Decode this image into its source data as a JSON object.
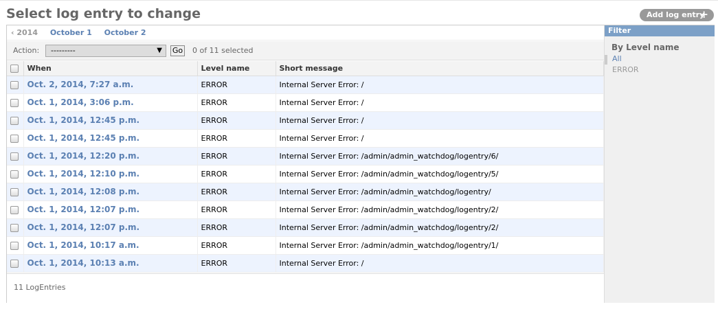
{
  "page": {
    "title": "Select log entry to change",
    "add_button": "Add log entry",
    "add_icon": "+"
  },
  "date_hierarchy": {
    "back": "‹ 2014",
    "items": [
      "October 1",
      "October 2"
    ]
  },
  "actions": {
    "label": "Action:",
    "selected_value": "---------",
    "caret": "▼",
    "go": "Go",
    "count": "0 of 11 selected"
  },
  "table": {
    "headers": [
      "When",
      "Level name",
      "Short message"
    ],
    "rows": [
      {
        "when": "Oct. 2, 2014, 7:27 a.m.",
        "level": "ERROR",
        "message": "Internal Server Error: /"
      },
      {
        "when": "Oct. 1, 2014, 3:06 p.m.",
        "level": "ERROR",
        "message": "Internal Server Error: /"
      },
      {
        "when": "Oct. 1, 2014, 12:45 p.m.",
        "level": "ERROR",
        "message": "Internal Server Error: /"
      },
      {
        "when": "Oct. 1, 2014, 12:45 p.m.",
        "level": "ERROR",
        "message": "Internal Server Error: /"
      },
      {
        "when": "Oct. 1, 2014, 12:20 p.m.",
        "level": "ERROR",
        "message": "Internal Server Error: /admin/admin_watchdog/logentry/6/"
      },
      {
        "when": "Oct. 1, 2014, 12:10 p.m.",
        "level": "ERROR",
        "message": "Internal Server Error: /admin/admin_watchdog/logentry/5/"
      },
      {
        "when": "Oct. 1, 2014, 12:08 p.m.",
        "level": "ERROR",
        "message": "Internal Server Error: /admin/admin_watchdog/logentry/"
      },
      {
        "when": "Oct. 1, 2014, 12:07 p.m.",
        "level": "ERROR",
        "message": "Internal Server Error: /admin/admin_watchdog/logentry/2/"
      },
      {
        "when": "Oct. 1, 2014, 12:07 p.m.",
        "level": "ERROR",
        "message": "Internal Server Error: /admin/admin_watchdog/logentry/2/"
      },
      {
        "when": "Oct. 1, 2014, 10:17 a.m.",
        "level": "ERROR",
        "message": "Internal Server Error: /admin/admin_watchdog/logentry/1/"
      },
      {
        "when": "Oct. 1, 2014, 10:13 a.m.",
        "level": "ERROR",
        "message": "Internal Server Error: /"
      }
    ]
  },
  "paginator": {
    "text": "11 LogEntries"
  },
  "filter": {
    "heading": "Filter",
    "group_title": "By Level name",
    "options": [
      "All",
      "ERROR"
    ]
  },
  "colors": {
    "link": "#5b80b2",
    "filter_header": "#7ca0c7",
    "row_alt": "#edf3fe",
    "button": "#999999"
  }
}
